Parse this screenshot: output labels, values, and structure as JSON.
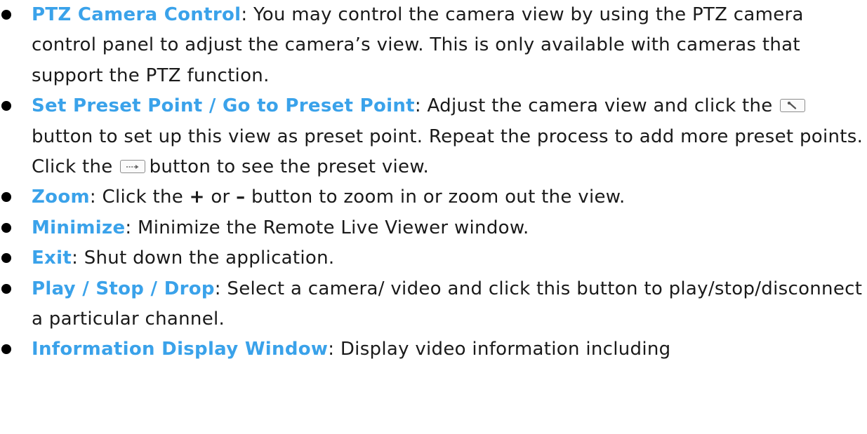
{
  "items": [
    {
      "term": "PTZ Camera Control",
      "sep": ": ",
      "text": "You may control the camera view by using the PTZ camera control panel to adjust the camera’s view. This is only available with cameras that support the PTZ function."
    },
    {
      "term": "Set Preset Point / Go to Preset Point",
      "sep": ": ",
      "text_a": "Adjust the camera view and click the",
      "icon_a": "wrench-icon",
      "text_b": "button to set up this view as preset point. Repeat the process to add more preset points. Click the",
      "icon_b": "arrow-right-icon",
      "text_c": "button to see the preset view."
    },
    {
      "term": "Zoom",
      "sep": ": ",
      "text_a": "Click the ",
      "plus": "+",
      "text_b": " or ",
      "minus": "–",
      "text_c": " button to zoom in or zoom out the view."
    },
    {
      "term": "Minimize",
      "sep": ": ",
      "text": "Minimize the Remote Live Viewer window."
    },
    {
      "term": "Exit",
      "sep": ": ",
      "text": "Shut down the application."
    },
    {
      "term": "Play / Stop / Drop",
      "sep": ": ",
      "text": "Select a camera/ video and click this button to play/stop/disconnect a particular channel."
    },
    {
      "term": "Information Display Window",
      "sep": ": ",
      "text": "Display video information including"
    }
  ]
}
